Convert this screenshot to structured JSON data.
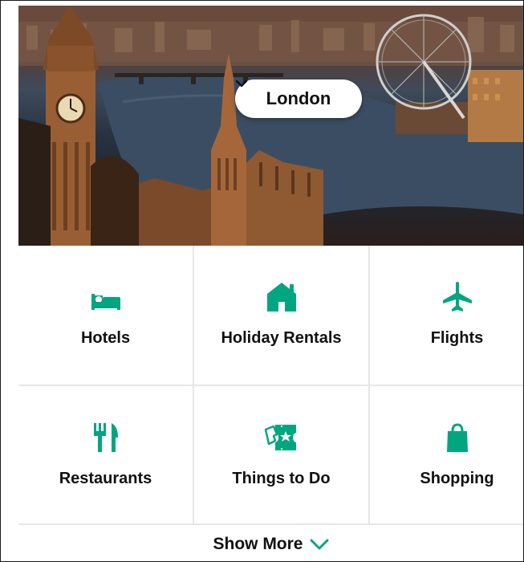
{
  "hero": {
    "city": "London",
    "dropdown_icon": "chevron-down-icon"
  },
  "categories": [
    {
      "label": "Hotels",
      "icon": "bed-icon"
    },
    {
      "label": "Holiday Rentals",
      "icon": "house-icon"
    },
    {
      "label": "Flights",
      "icon": "airplane-icon"
    },
    {
      "label": "Restaurants",
      "icon": "fork-knife-icon"
    },
    {
      "label": "Things to Do",
      "icon": "ticket-icon"
    },
    {
      "label": "Shopping",
      "icon": "shopping-bag-icon"
    }
  ],
  "show_more": {
    "label": "Show More",
    "icon": "chevron-down-icon"
  },
  "colors": {
    "accent": "#00a680",
    "text": "#111111",
    "divider": "#e6e6e6"
  }
}
